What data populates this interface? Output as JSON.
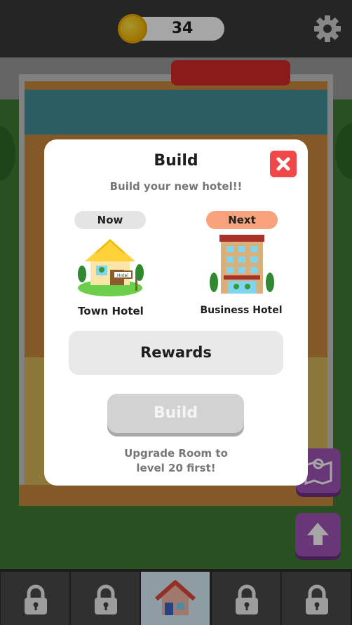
{
  "header": {
    "coins": "34",
    "icons": {
      "coin": "gold-coin-icon",
      "settings": "gear-icon"
    }
  },
  "modal": {
    "title": "Build",
    "subtitle": "Build your new hotel!!",
    "close_icon": "close-icon",
    "current": {
      "tag": "Now",
      "name": "Town Hotel"
    },
    "next": {
      "tag": "Next",
      "name": "Business Hotel"
    },
    "rewards_label": "Rewards",
    "build_label": "Build",
    "hint_line1": "Upgrade Room to",
    "hint_line2": "level 20 first!"
  },
  "side_buttons": {
    "map_icon": "map-pin-icon",
    "upgrade_icon": "arrow-up-icon"
  },
  "bottom_nav": {
    "items": [
      {
        "icon": "lock-icon",
        "active": false
      },
      {
        "icon": "lock-icon",
        "active": false
      },
      {
        "icon": "home-icon",
        "active": true
      },
      {
        "icon": "lock-icon",
        "active": false
      },
      {
        "icon": "lock-icon",
        "active": false
      }
    ]
  },
  "colors": {
    "close": "#f04848",
    "next_tag": "#f8a37e",
    "purple_button": "#a253b8",
    "active_tab": "#d9f1fb"
  }
}
